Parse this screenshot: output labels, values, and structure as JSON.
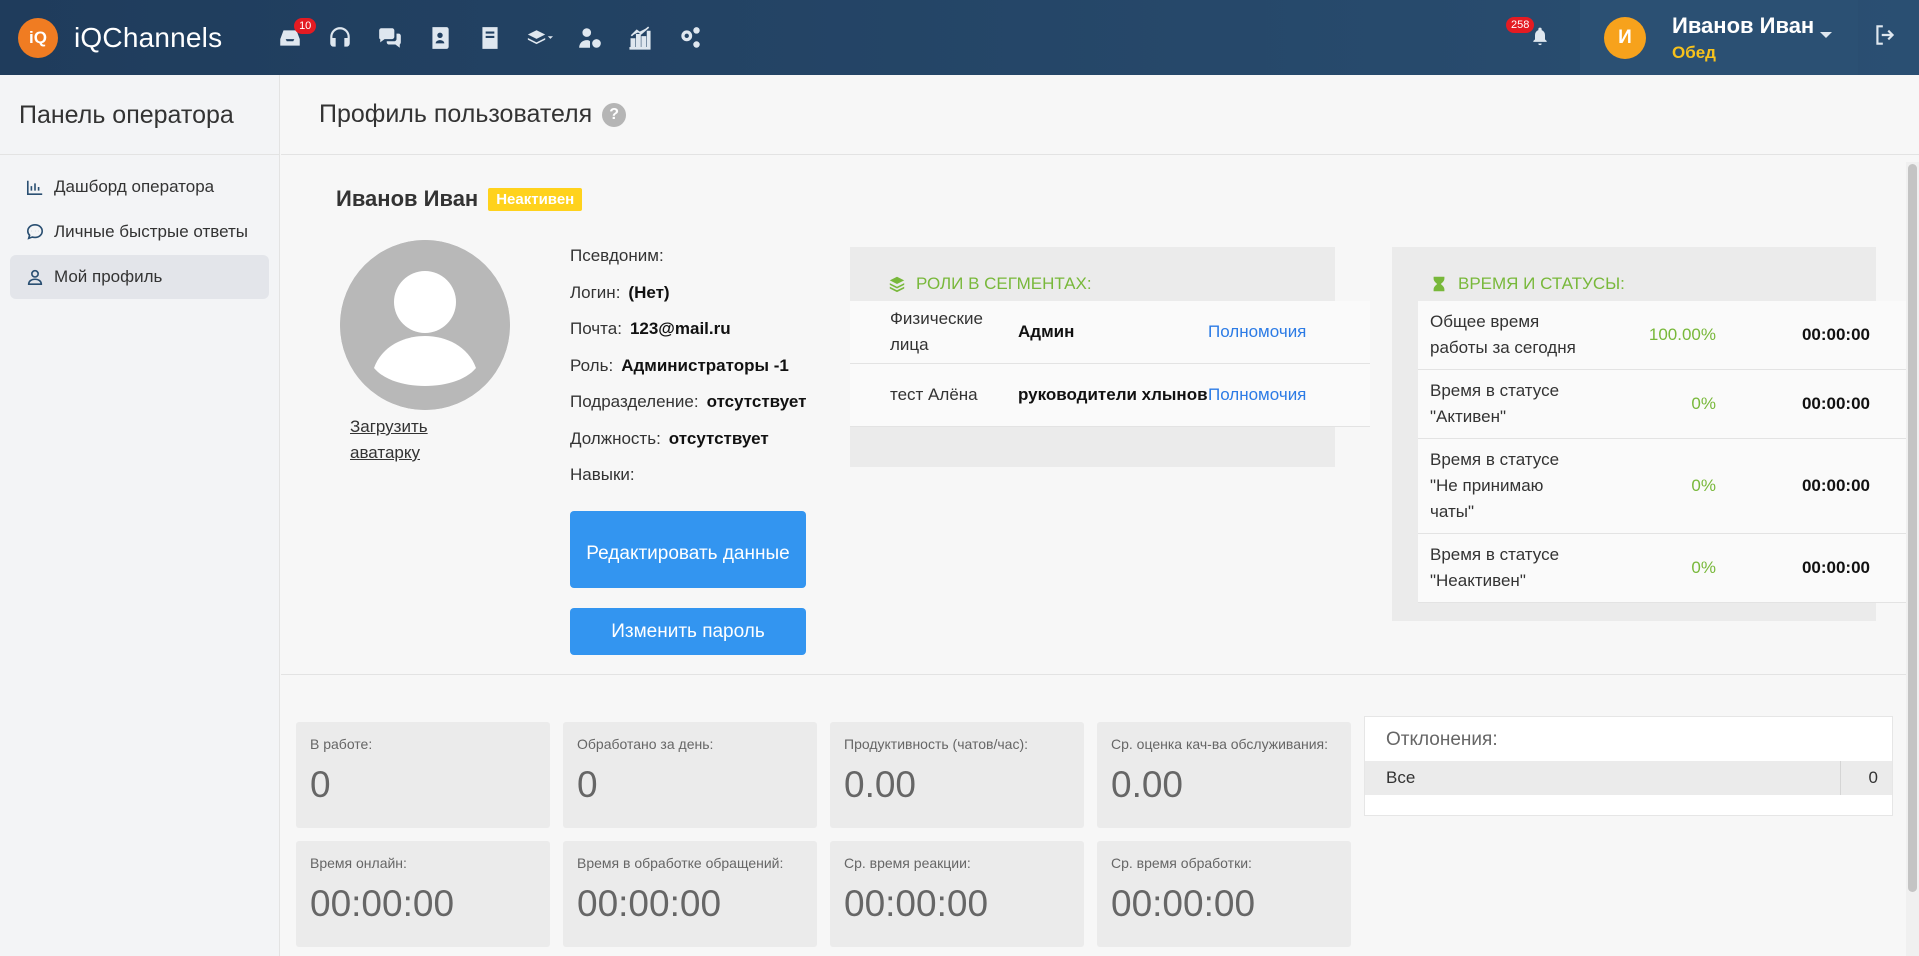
{
  "app": {
    "logo_text": "iQ",
    "name": "iQChannels"
  },
  "topnav": {
    "inbox_badge": "10",
    "notifications_badge": "258"
  },
  "user": {
    "avatar_letter": "И",
    "name": "Иванов Иван",
    "status": "Обед"
  },
  "sidebar": {
    "title": "Панель оператора",
    "items": [
      {
        "label": "Дашборд оператора",
        "icon": "chart-bar-icon"
      },
      {
        "label": "Личные быстрые ответы",
        "icon": "chat-icon"
      },
      {
        "label": "Мой профиль",
        "icon": "user-icon",
        "active": true
      }
    ]
  },
  "page": {
    "title": "Профиль пользователя",
    "help": "?"
  },
  "profile": {
    "name": "Иванов Иван",
    "status_badge": "Неактивен",
    "upload_avatar": "Загрузить аватарку",
    "fields": [
      {
        "label": "Псевдоним:",
        "value": ""
      },
      {
        "label": "Логин:",
        "value": "(Нет)"
      },
      {
        "label": "Почта:",
        "value": "123@mail.ru"
      },
      {
        "label": "Роль:",
        "value": "Администраторы -1"
      },
      {
        "label": "Подразделение:",
        "value": "отсутствует"
      },
      {
        "label": "Должность:",
        "value": "отсутствует"
      },
      {
        "label": "Навыки:",
        "value": ""
      }
    ],
    "edit_button": "Редактировать данные",
    "password_button": "Изменить пароль"
  },
  "roles": {
    "title": "РОЛИ В СЕГМЕНТАХ:",
    "rows": [
      {
        "segment": "Физические лица",
        "role": "Админ",
        "link": "Полномочия"
      },
      {
        "segment": "тест Алёна",
        "role": "руководители хлынов",
        "link": "Полномочия"
      }
    ]
  },
  "times": {
    "title": "ВРЕМЯ И СТАТУСЫ:",
    "rows": [
      {
        "label": "Общее время работы за сегодня",
        "percent": "100.00%",
        "time": "00:00:00"
      },
      {
        "label": "Время в статусе \"Активен\"",
        "percent": "0%",
        "time": "00:00:00"
      },
      {
        "label": "Время в статусе \"Не принимаю чаты\"",
        "percent": "0%",
        "time": "00:00:00"
      },
      {
        "label": "Время в статусе \"Неактивен\"",
        "percent": "0%",
        "time": "00:00:00"
      }
    ]
  },
  "stats": [
    {
      "label": "В работе:",
      "value": "0"
    },
    {
      "label": "Обработано за день:",
      "value": "0"
    },
    {
      "label": "Продуктивность (чатов/час):",
      "value": "0.00"
    },
    {
      "label": "Ср. оценка кач-ва обслуживания:",
      "value": "0.00"
    },
    {
      "label": "Время онлайн:",
      "value": "00:00:00"
    },
    {
      "label": "Время в обработке обращений:",
      "value": "00:00:00"
    },
    {
      "label": "Ср. время реакции:",
      "value": "00:00:00"
    },
    {
      "label": "Ср. время обработки:",
      "value": "00:00:00"
    }
  ],
  "deviations": {
    "title": "Отклонения:",
    "rows": [
      {
        "name": "Все",
        "count": "0"
      }
    ]
  },
  "colors": {
    "topbar": "#1f3c5c",
    "accent_blue": "#3395f0",
    "accent_green": "#78b83a",
    "badge_yellow": "#ffd21c",
    "badge_red": "#e41b22",
    "avatar_orange": "#f7a21c"
  }
}
